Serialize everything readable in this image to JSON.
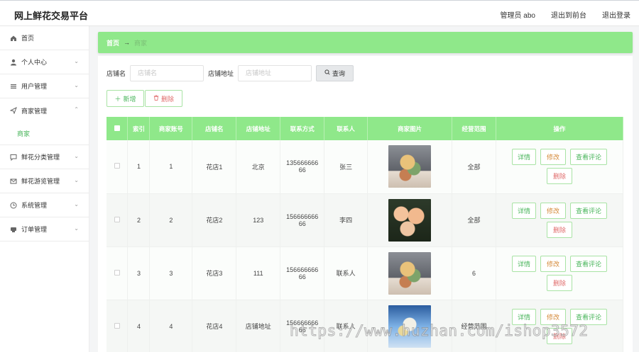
{
  "app": {
    "title": "网上鲜花交易平台"
  },
  "topbar": {
    "user": "管理员 abo",
    "to_front": "退出到前台",
    "logout": "退出登录"
  },
  "sidebar": {
    "items": [
      {
        "label": "首页",
        "icon": "home-icon",
        "chevron": false
      },
      {
        "label": "个人中心",
        "icon": "user-icon",
        "chevron": true
      },
      {
        "label": "用户管理",
        "icon": "list-icon",
        "chevron": true
      },
      {
        "label": "商家管理",
        "icon": "send-icon",
        "chevron": true,
        "open": true
      },
      {
        "label": "鲜花分类管理",
        "icon": "chat-icon",
        "chevron": true
      },
      {
        "label": "鲜花游览管理",
        "icon": "mail-icon",
        "chevron": true
      },
      {
        "label": "系统管理",
        "icon": "clock-icon",
        "chevron": true
      },
      {
        "label": "订单管理",
        "icon": "printer-icon",
        "chevron": true
      }
    ],
    "submenu_active": "商家"
  },
  "breadcrumb": {
    "home": "首页",
    "arrow": "→",
    "current": "商家"
  },
  "search": {
    "shop_name_label": "店铺名",
    "shop_name_placeholder": "店铺名",
    "shop_addr_label": "店铺地址",
    "shop_addr_placeholder": "店铺地址",
    "query_label": "查询"
  },
  "actions": {
    "add": "新增",
    "delete": "删除"
  },
  "table": {
    "headers": [
      "",
      "索引",
      "商家账号",
      "店铺名",
      "店铺地址",
      "联系方式",
      "联系人",
      "商家图片",
      "经营范围",
      "操作"
    ],
    "row_ops": {
      "view": "详情",
      "edit": "修改",
      "comments": "查看评论",
      "delete": "删除"
    },
    "rows": [
      {
        "index": "1",
        "account": "1",
        "name": "花店1",
        "address": "北京",
        "phone": "13566666666",
        "contact": "张三",
        "scope": "全部"
      },
      {
        "index": "2",
        "account": "2",
        "name": "花店2",
        "address": "123",
        "phone": "15666666666",
        "contact": "李四",
        "scope": "全部"
      },
      {
        "index": "3",
        "account": "3",
        "name": "花店3",
        "address": "111",
        "phone": "15666666666",
        "contact": "联系人",
        "scope": "6"
      },
      {
        "index": "4",
        "account": "4",
        "name": "花店4",
        "address": "店铺地址",
        "phone": "15666666666",
        "contact": "联系人",
        "scope": "经营范围"
      }
    ]
  },
  "watermark": "https://www.huzhan.com/ishop3572",
  "colors": {
    "accent": "#8fe88a",
    "accent_text": "#49b55b",
    "danger": "#e06c6c",
    "warn": "#d58a3a"
  }
}
